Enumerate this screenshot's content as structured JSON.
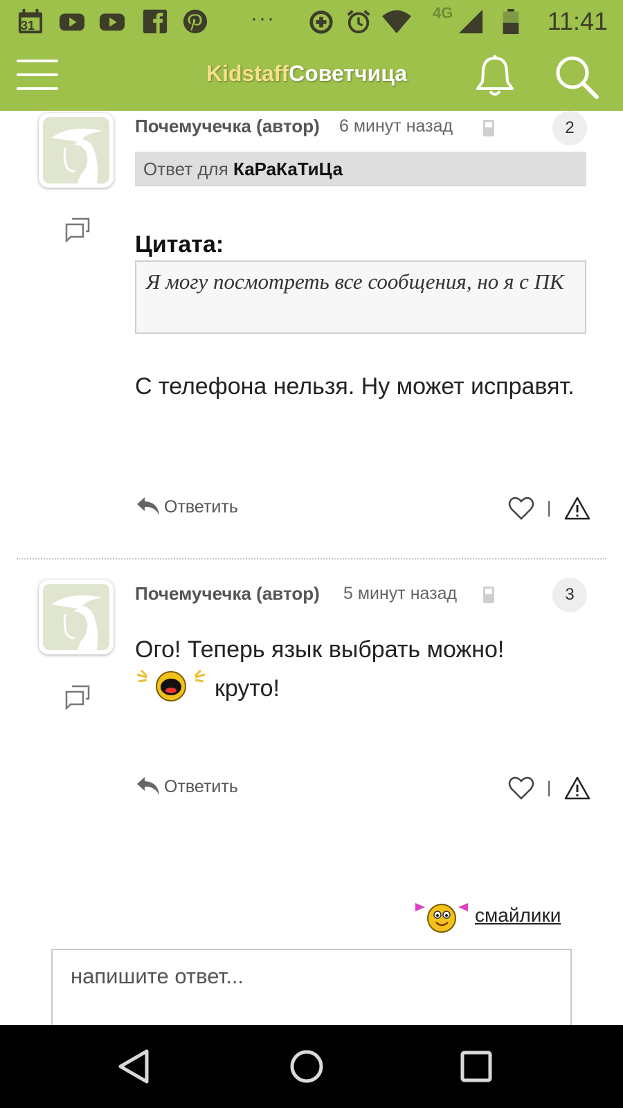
{
  "status_bar": {
    "time": "11:41",
    "network": "4G",
    "overflow": "···",
    "icons": [
      "calendar-icon",
      "youtube-icon",
      "youtube-icon",
      "facebook-icon",
      "pinterest-icon",
      "data-saver-icon",
      "alarm-icon",
      "wifi-icon",
      "signal-icon",
      "battery-icon"
    ],
    "calendar_day": "31"
  },
  "header": {
    "brand_part1": "Kidstaff",
    "brand_part2": "Советчица",
    "colors": {
      "bar": "#9dc14a",
      "brand_part1": "#f4e08a",
      "brand_part2": "#ffffff"
    }
  },
  "comments": [
    {
      "author": "Почемучечка (автор)",
      "time": "6 минут назад",
      "number": "2",
      "reply_to_prefix": "Ответ для ",
      "reply_to_name": "КаРаКаТиЦа",
      "quote_label": "Цитата:",
      "quote_text": "Я могу посмотреть все сообщения, но я с ПК",
      "text": "С телефона нельзя. Ну может исправят.",
      "reply_label": "Ответить",
      "separator": "|"
    },
    {
      "author": "Почемучечка (автор)",
      "time": "5 минут назад",
      "number": "3",
      "text_line1": "Ого! Теперь язык выбрать можно!",
      "text_line2": "круто!",
      "emoji": "laughing-smiley-emoji",
      "reply_label": "Ответить",
      "separator": "|"
    }
  ],
  "composer": {
    "smileys_label": "смайлики",
    "smileys_icon": "pigtails-smiley-emoji",
    "placeholder": "напишите ответ..."
  },
  "nav_bar": {
    "buttons": [
      "back-icon",
      "home-icon",
      "recents-icon"
    ]
  }
}
